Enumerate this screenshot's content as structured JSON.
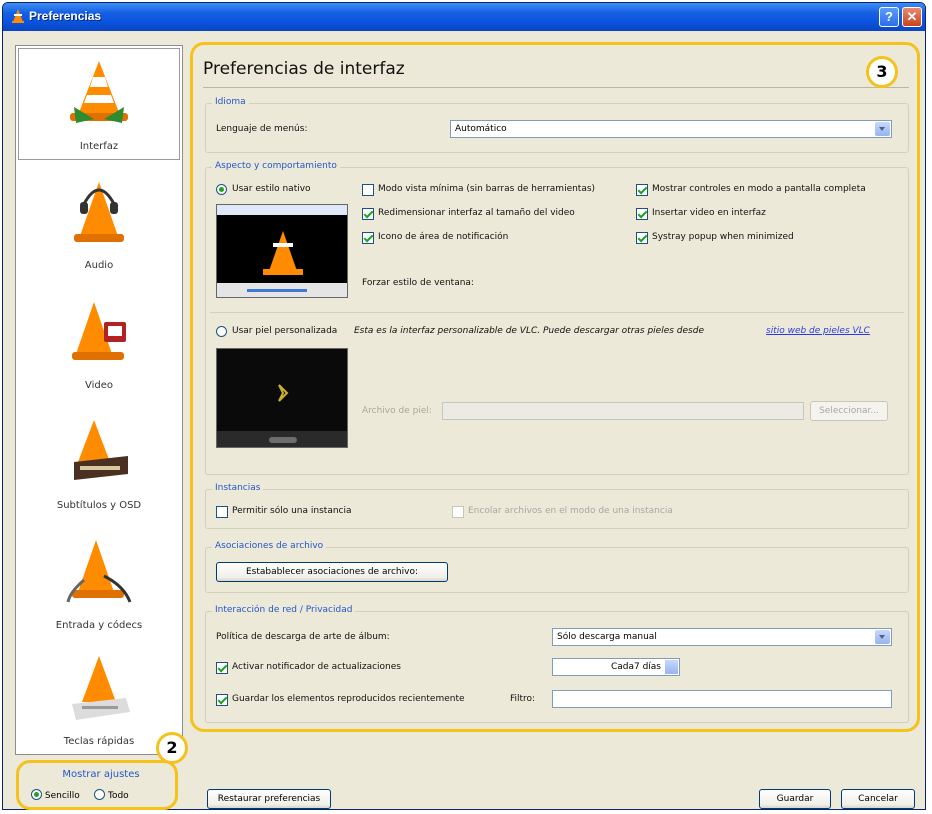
{
  "window": {
    "title": "Preferencias"
  },
  "sidebar": {
    "items": [
      {
        "label": "Interfaz",
        "icon": "vlc-cone-interface-icon"
      },
      {
        "label": "Audio",
        "icon": "vlc-cone-headphones-icon"
      },
      {
        "label": "Video",
        "icon": "vlc-cone-film-icon"
      },
      {
        "label": "Subtítulos y OSD",
        "icon": "vlc-cone-subtitles-icon"
      },
      {
        "label": "Entrada y códecs",
        "icon": "vlc-cone-cables-icon"
      },
      {
        "label": "Teclas rápidas",
        "icon": "vlc-cone-keyboard-icon"
      }
    ],
    "show_settings": {
      "legend": "Mostrar ajustes",
      "simple": "Sencillo",
      "all": "Todo"
    }
  },
  "main": {
    "title": "Preferencias de interfaz",
    "language": {
      "group": "Idioma",
      "label": "Lenguaje de menús:",
      "value": "Automático"
    },
    "look": {
      "group": "Aspecto y comportamiento",
      "native_style": "Usar estilo nativo",
      "minimal_view": "Modo vista mínima (sin barras de herramientas)",
      "fullscreen_controls": "Mostrar controles en modo a pantalla completa",
      "resize_interface": "Redimensionar interfaz al tamaño del video",
      "embed_video": "Insertar video en interfaz",
      "systray_icon": "Icono de área de notificación",
      "systray_popup": "Systray popup when minimized",
      "force_style": "Forzar estilo de ventana:",
      "custom_skin": "Usar piel personalizada",
      "custom_skin_desc": "Esta es la interfaz personalizable de VLC. Puede descargar otras pieles desde",
      "skins_link": "sitio web de pieles VLC",
      "skin_file_label": "Archivo de piel:",
      "select_button": "Seleccionar..."
    },
    "instances": {
      "group": "Instancias",
      "one_instance": "Permitir sólo una instancia",
      "enqueue": "Encolar archivos en el modo de una instancia"
    },
    "file_assoc": {
      "group": "Asociaciones de archivo",
      "button": "Estabablecer asociaciones de archivo:"
    },
    "network": {
      "group": "Interacción de red / Privacidad",
      "album_art_label": "Política de descarga de arte de álbum:",
      "album_art_value": "Sólo descarga manual",
      "update_notifier": "Activar notificador de actualizaciones",
      "update_interval": "Cada7 días",
      "save_recent": "Guardar los elementos reproducidos recientemente",
      "filter_label": "Filtro:"
    }
  },
  "footer": {
    "reset": "Restaurar preferencias",
    "save": "Guardar",
    "cancel": "Cancelar"
  },
  "callouts": {
    "main_panel": "3",
    "show_settings": "2"
  },
  "colors": {
    "callout": "#f5c21b",
    "group_label": "#2257c9",
    "titlebar": "#0a52dc"
  }
}
